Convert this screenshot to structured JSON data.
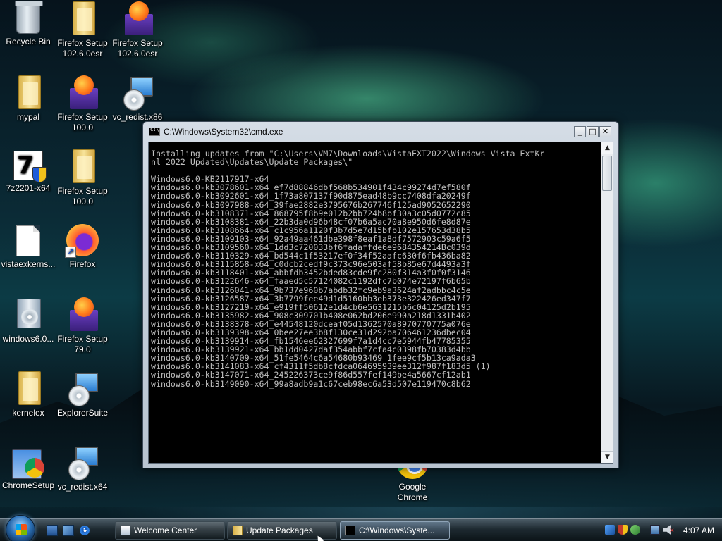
{
  "desktop": {
    "icons": [
      {
        "label": "Recycle Bin",
        "icon": "recycle-bin-icon"
      },
      {
        "label": "Firefox Setup\n102.6.0esr",
        "icon": "folder-icon"
      },
      {
        "label": "Firefox Setup\n102.6.0esr",
        "icon": "firefox-installer-icon"
      },
      {
        "label": "mypal",
        "icon": "folder-icon"
      },
      {
        "label": "Firefox Setup\n100.0",
        "icon": "firefox-installer-icon"
      },
      {
        "label": "vc_redist.x86",
        "icon": "setup-icon"
      },
      {
        "label": "7z2201-x64",
        "icon": "7zip-installer-icon"
      },
      {
        "label": "Firefox Setup\n100.0",
        "icon": "folder-icon"
      },
      {
        "label": "vistaexkerns...",
        "icon": "document-icon"
      },
      {
        "label": "Firefox",
        "icon": "firefox-icon"
      },
      {
        "label": "windows6.0...",
        "icon": "installer-package-icon"
      },
      {
        "label": "Firefox Setup\n79.0",
        "icon": "firefox-installer-icon"
      },
      {
        "label": "kernelex",
        "icon": "folder-icon"
      },
      {
        "label": "ExplorerSuite",
        "icon": "setup-icon"
      },
      {
        "label": "ChromeSetup",
        "icon": "chrome-installer-icon"
      },
      {
        "label": "vc_redist.x64",
        "icon": "setup-icon"
      },
      {
        "label": "Google\nChrome",
        "icon": "google-chrome-icon"
      }
    ]
  },
  "cmd_window": {
    "title": "C:\\Windows\\System32\\cmd.exe",
    "buttons": {
      "minimize": "_",
      "maximize": "□",
      "close": "✕"
    },
    "scroll_up": "▲",
    "scroll_down": "▼",
    "lines": [
      "Installing updates from \"C:\\Users\\VM7\\Downloads\\VistaEXT2022\\Windows Vista ExtKr",
      "nl 2022 Updated\\Updates\\Update Packages\\\"",
      "",
      "Windows6.0-KB2117917-x64",
      "windows6.0-kb3078601-x64_ef7d88846dbf568b534901f434c99274d7ef580f",
      "windows6.0-kb3092601-x64_1f73a807137f90d875ead48b9cc7408dfa20249f",
      "windows6.0-kb3097988-x64_39fae2882e3795676b267746f125ad9052652290",
      "windows6.0-kb3108371-x64_868795f8b9e012b2bb724b8bf30a3c05d0772c85",
      "windows6.0-kb3108381-x64_22b3da0d96b48cf07b6a5ac70a8e950d6fe8d87e",
      "windows6.0-kb3108664-x64_c1c956a1120f3b7d5e7d15bfb102e157653d38b5",
      "windows6.0-kb3109103-x64_92a49aa461dbe398f8eaf1a8df7572903c59a6f5",
      "windows6.0-kb3109560-x64_1dd3c720033bf6fadaffde6e9684354214Bc039d",
      "windows6.0-kb3110329-x64_bd544c1f53217ef0f34f52aafc630f6fb436ba82",
      "windows6.0-kb3115858-x64_c0dcb2cedf9c373c96e503af58b85e67d4493a3f",
      "windows6.0-kb3118401-x64_abbfdb3452bded83cde9fc280f314a3f0f0f3146",
      "windows6.0-kb3122646-x64_faaed5c57124082c1192dfc7b074e72197f6b65b",
      "windows6.0-kb3126041-x64_9b737e960b7abdb32fc9eb9a3624af2adbbc4c5e",
      "windows6.0-kb3126587-x64_3b7799fee49d1d5160bb3eb373e322426ed347f7",
      "windows6.0-kb3127219-x64_e919ff50612e1d4cb6e5631215b6c04125d2b195",
      "windows6.0-kb3135982-x64_908c309701b408e062bd206e990a218d1331b402",
      "windows6.0-kb3138378-x64_e44548120dceaf05d1362570a8970770775a076e",
      "windows6.0-kb3139398-x64_0bee27ee3b8f130ce31d292ba706461236dbec04",
      "windows6.0-kb3139914-x64_fb1546ee62327699f7a1d4cc7e5944fb47785355",
      "windows6.0-kb3139921-x64_bb1dd0427daf354abbf7cfa4c0398fb70383d4bb",
      "windows6.0-kb3140709-x64_51fe5464c6a54680b93469 1fee9cf5b13ca9ada3",
      "windows6.0-kb3141083-x64_cf4311f5db8cfdca064695939ee312f987f183d5 (1)",
      "windows6.0-kb3147071-x64_245226373ce9f86d557fef149be4a5667cf12ab1",
      "windows6.0-kb3149090-x64_99a8adb9a1c67ceb98ec6a53d507e119470c8b62"
    ]
  },
  "taskbar": {
    "tasks": [
      {
        "label": "Welcome Center"
      },
      {
        "label": "Update Packages"
      },
      {
        "label": "C:\\Windows\\Syste..."
      }
    ],
    "clock": "4:07 AM",
    "volume_muted_mark": "✕"
  }
}
